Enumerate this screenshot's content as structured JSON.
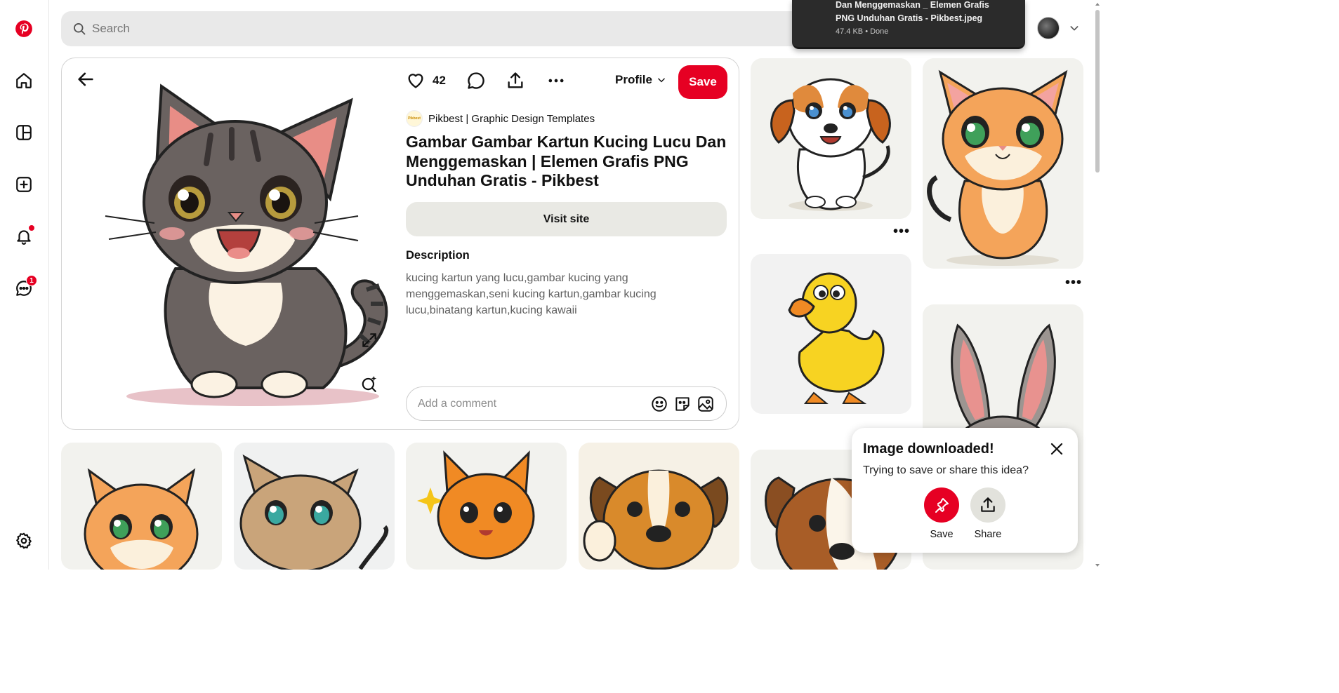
{
  "search": {
    "placeholder": "Search"
  },
  "sidebar": {
    "items": [
      {
        "name": "pinterest-logo"
      },
      {
        "name": "home"
      },
      {
        "name": "boards"
      },
      {
        "name": "create"
      },
      {
        "name": "notifications"
      },
      {
        "name": "messages",
        "badge": "1"
      },
      {
        "name": "settings"
      }
    ]
  },
  "download": {
    "filename_line1": "Dan Menggemaskan _ Elemen Grafis",
    "filename_line2": "PNG Unduhan Gratis - Pikbest.jpeg",
    "status": "47.4 KB • Done"
  },
  "pin": {
    "like_count": "42",
    "profile_label": "Profile",
    "save_label": "Save",
    "creator_logo_text": "Pikbest",
    "creator_name": "Pikbest | Graphic Design Templates",
    "title": "Gambar Gambar Kartun Kucing Lucu Dan Menggemaskan | Elemen Grafis PNG Unduhan Gratis - Pikbest",
    "visit_label": "Visit site",
    "description_heading": "Description",
    "description": "kucing kartun yang lucu,gambar kucing yang menggemaskan,seni kucing kartun,gambar kucing lucu,binatang kartun,kucing kawaii",
    "comment_placeholder": "Add a comment"
  },
  "toast": {
    "title": "Image downloaded!",
    "subtitle": "Trying to save or share this idea?",
    "save_label": "Save",
    "share_label": "Share"
  },
  "colors": {
    "brand": "#e60023",
    "card_bg": "#f2f2ee",
    "button_bg": "#e9e9e4"
  }
}
